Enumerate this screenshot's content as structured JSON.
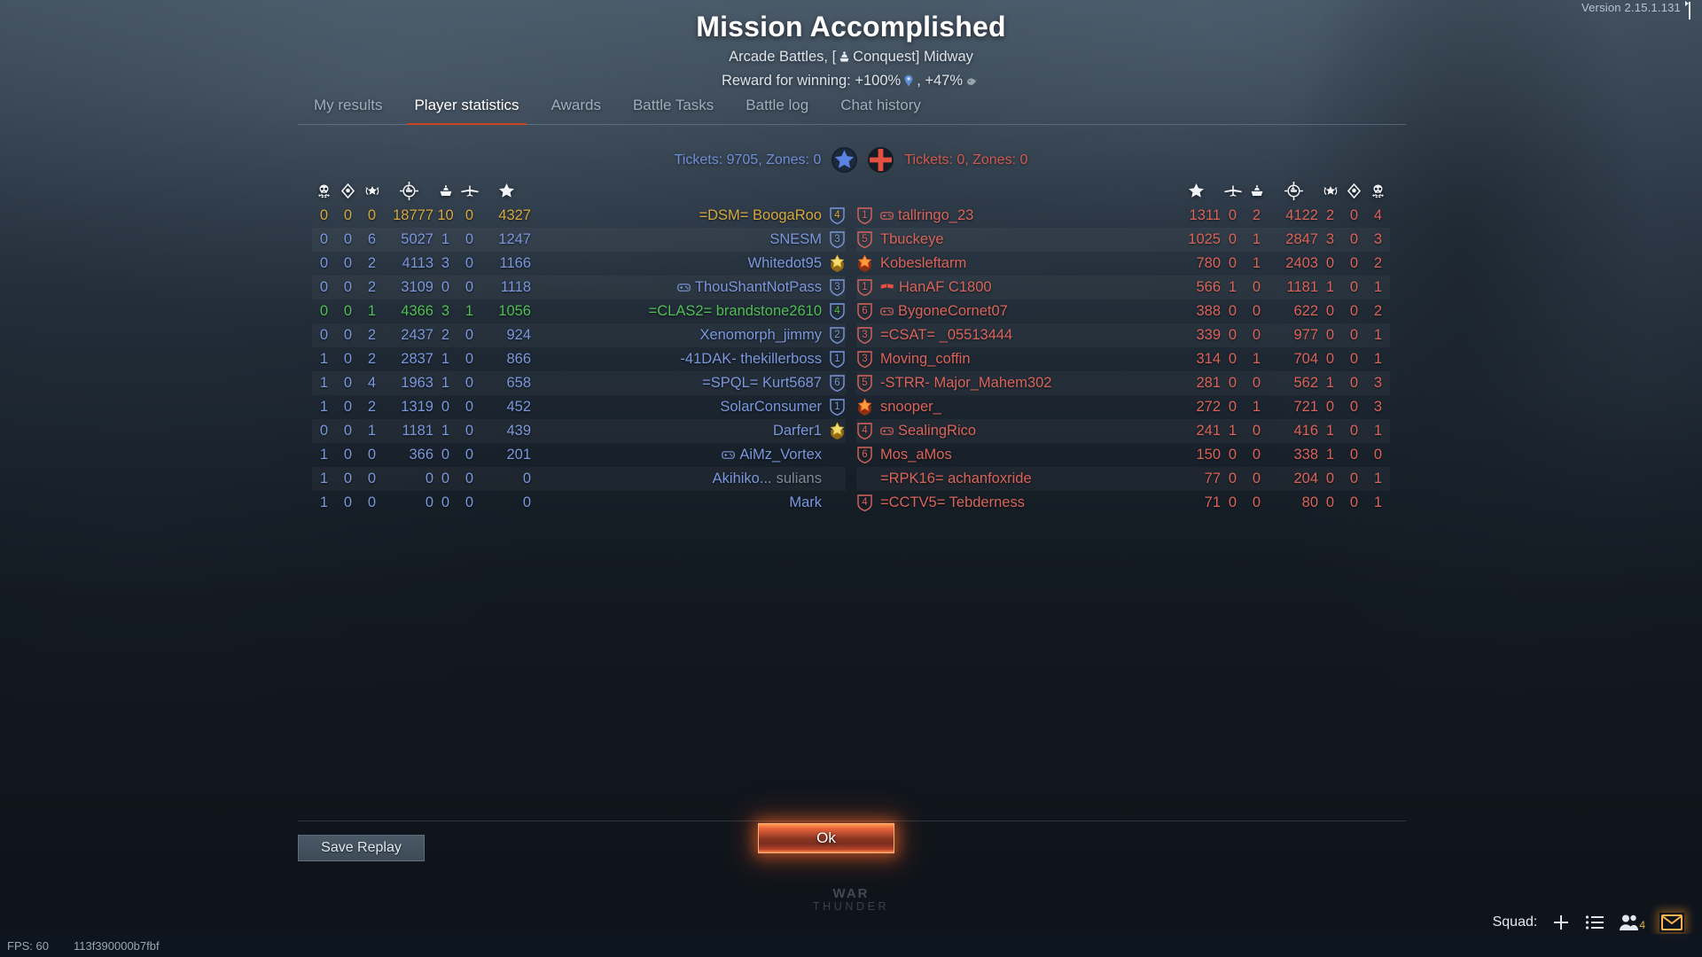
{
  "version_label": "Version 2.15.1.131",
  "header": {
    "title": "Mission Accomplished",
    "mode_prefix": "Arcade Battles, [",
    "mode_name": "Conquest",
    "mode_suffix": "] Midway",
    "reward_prefix": "Reward for winning: +100%",
    "reward_mid": ", +47%"
  },
  "tabs": [
    {
      "label": "My results",
      "active": false
    },
    {
      "label": "Player statistics",
      "active": true
    },
    {
      "label": "Awards",
      "active": false
    },
    {
      "label": "Battle Tasks",
      "active": false
    },
    {
      "label": "Battle log",
      "active": false
    },
    {
      "label": "Chat history",
      "active": false
    }
  ],
  "tickets": {
    "blue": "Tickets: 9705, Zones: 0",
    "red": "Tickets: 0, Zones: 0",
    "blue_color": "#6f8fd6",
    "red_color": "#cf5a4e"
  },
  "columns": {
    "left": [
      "skull-icon",
      "diamond-icon",
      "wreath-star-icon",
      "crosshair-ship-icon",
      "ship-icon",
      "plane-icon",
      "star-icon"
    ],
    "right": [
      "star-icon",
      "plane-icon",
      "ship-icon",
      "crosshair-ship-icon",
      "wreath-star-icon",
      "diamond-icon",
      "skull-icon"
    ]
  },
  "teams": {
    "left": {
      "side": "blue",
      "rows": [
        {
          "deaths": "0",
          "captures": "0",
          "assists": "0",
          "score_damage": "18777",
          "ships": "10",
          "planes": "0",
          "score": "4327",
          "name": "=DSM= BoogaRoo",
          "name_dim": "",
          "badge": "4",
          "badge_type": "shield",
          "prefix_icon": "",
          "color": "gold"
        },
        {
          "deaths": "0",
          "captures": "0",
          "assists": "6",
          "score_damage": "5027",
          "ships": "1",
          "planes": "0",
          "score": "1247",
          "name": "SNESM",
          "name_dim": "",
          "badge": "3",
          "badge_type": "shield",
          "prefix_icon": "",
          "color": "blue"
        },
        {
          "deaths": "0",
          "captures": "0",
          "assists": "2",
          "score_damage": "4113",
          "ships": "3",
          "planes": "0",
          "score": "1166",
          "name": "Whitedot95",
          "name_dim": "",
          "badge": "",
          "badge_type": "gold-star",
          "prefix_icon": "",
          "color": "blue"
        },
        {
          "deaths": "0",
          "captures": "0",
          "assists": "2",
          "score_damage": "3109",
          "ships": "0",
          "planes": "0",
          "score": "1118",
          "name": "ThouShantNotPass",
          "name_dim": "",
          "badge": "3",
          "badge_type": "shield",
          "prefix_icon": "gamepad-icon",
          "color": "blue"
        },
        {
          "deaths": "0",
          "captures": "0",
          "assists": "1",
          "score_damage": "4366",
          "ships": "3",
          "planes": "1",
          "score": "1056",
          "name": "=CLAS2= brandstone2610",
          "name_dim": "",
          "badge": "4",
          "badge_type": "shield",
          "prefix_icon": "",
          "color": "green"
        },
        {
          "deaths": "0",
          "captures": "0",
          "assists": "2",
          "score_damage": "2437",
          "ships": "2",
          "planes": "0",
          "score": "924",
          "name": "Xenomorph_jimmy",
          "name_dim": "",
          "badge": "2",
          "badge_type": "shield",
          "prefix_icon": "",
          "color": "blue"
        },
        {
          "deaths": "1",
          "captures": "0",
          "assists": "2",
          "score_damage": "2837",
          "ships": "1",
          "planes": "0",
          "score": "866",
          "name": "-41DAK- thekillerboss",
          "name_dim": "",
          "badge": "1",
          "badge_type": "shield",
          "prefix_icon": "",
          "color": "blue"
        },
        {
          "deaths": "1",
          "captures": "0",
          "assists": "4",
          "score_damage": "1963",
          "ships": "1",
          "planes": "0",
          "score": "658",
          "name": "=SPQL= Kurt5687",
          "name_dim": "",
          "badge": "6",
          "badge_type": "shield",
          "prefix_icon": "",
          "color": "blue"
        },
        {
          "deaths": "1",
          "captures": "0",
          "assists": "2",
          "score_damage": "1319",
          "ships": "0",
          "planes": "0",
          "score": "452",
          "name": "SolarConsumer",
          "name_dim": "",
          "badge": "1",
          "badge_type": "shield",
          "prefix_icon": "",
          "color": "blue"
        },
        {
          "deaths": "0",
          "captures": "0",
          "assists": "1",
          "score_damage": "1181",
          "ships": "1",
          "planes": "0",
          "score": "439",
          "name": "Darfer1",
          "name_dim": "",
          "badge": "",
          "badge_type": "gold-star",
          "prefix_icon": "",
          "color": "blue"
        },
        {
          "deaths": "1",
          "captures": "0",
          "assists": "0",
          "score_damage": "366",
          "ships": "0",
          "planes": "0",
          "score": "201",
          "name": "AiMz_Vortex",
          "name_dim": "",
          "badge": "",
          "badge_type": "none",
          "prefix_icon": "gamepad-icon",
          "color": "blue"
        },
        {
          "deaths": "1",
          "captures": "0",
          "assists": "0",
          "score_damage": "0",
          "ships": "0",
          "planes": "0",
          "score": "0",
          "name": "Akihiko...",
          "name_dim": "sulians",
          "badge": "",
          "badge_type": "none",
          "prefix_icon": "",
          "color": "blue"
        },
        {
          "deaths": "1",
          "captures": "0",
          "assists": "0",
          "score_damage": "0",
          "ships": "0",
          "planes": "0",
          "score": "0",
          "name": "Mark",
          "name_dim": "",
          "badge": "",
          "badge_type": "none",
          "prefix_icon": "",
          "color": "blue"
        }
      ]
    },
    "right": {
      "side": "red",
      "rows": [
        {
          "score": "1311",
          "planes": "0",
          "ships": "2",
          "score_damage": "4122",
          "assists": "2",
          "captures": "0",
          "deaths": "4",
          "name": "tallringo_23",
          "name_dim": "",
          "badge": "1",
          "badge_type": "shield",
          "prefix_icon": "gamepad-icon",
          "color": "red"
        },
        {
          "score": "1025",
          "planes": "0",
          "ships": "1",
          "score_damage": "2847",
          "assists": "3",
          "captures": "0",
          "deaths": "3",
          "name": "Tbuckeye",
          "name_dim": "",
          "badge": "5",
          "badge_type": "shield",
          "prefix_icon": "",
          "color": "red"
        },
        {
          "score": "780",
          "planes": "0",
          "ships": "1",
          "score_damage": "2403",
          "assists": "0",
          "captures": "0",
          "deaths": "2",
          "name": "Kobesleftarm",
          "name_dim": "",
          "badge": "",
          "badge_type": "orange-star",
          "prefix_icon": "",
          "color": "red"
        },
        {
          "score": "566",
          "planes": "1",
          "ships": "0",
          "score_damage": "1181",
          "assists": "1",
          "captures": "0",
          "deaths": "1",
          "name": "HanAF C1800",
          "name_dim": "",
          "badge": "1",
          "badge_type": "shield",
          "prefix_icon": "flag-icon",
          "color": "red"
        },
        {
          "score": "388",
          "planes": "0",
          "ships": "0",
          "score_damage": "622",
          "assists": "0",
          "captures": "0",
          "deaths": "2",
          "name": "BygoneCornet07",
          "name_dim": "",
          "badge": "6",
          "badge_type": "shield",
          "prefix_icon": "gamepad-icon",
          "color": "red"
        },
        {
          "score": "339",
          "planes": "0",
          "ships": "0",
          "score_damage": "977",
          "assists": "0",
          "captures": "0",
          "deaths": "1",
          "name": "=CSAT= _05513444",
          "name_dim": "",
          "badge": "3",
          "badge_type": "shield",
          "prefix_icon": "",
          "color": "red"
        },
        {
          "score": "314",
          "planes": "0",
          "ships": "1",
          "score_damage": "704",
          "assists": "0",
          "captures": "0",
          "deaths": "1",
          "name": "Moving_coffin",
          "name_dim": "",
          "badge": "3",
          "badge_type": "shield",
          "prefix_icon": "",
          "color": "red"
        },
        {
          "score": "281",
          "planes": "0",
          "ships": "0",
          "score_damage": "562",
          "assists": "1",
          "captures": "0",
          "deaths": "3",
          "name": "-STRR- Major_Mahem302",
          "name_dim": "",
          "badge": "5",
          "badge_type": "shield",
          "prefix_icon": "",
          "color": "red"
        },
        {
          "score": "272",
          "planes": "0",
          "ships": "1",
          "score_damage": "721",
          "assists": "0",
          "captures": "0",
          "deaths": "3",
          "name": "snooper_",
          "name_dim": "",
          "badge": "",
          "badge_type": "orange-star",
          "prefix_icon": "",
          "color": "red"
        },
        {
          "score": "241",
          "planes": "1",
          "ships": "0",
          "score_damage": "416",
          "assists": "1",
          "captures": "0",
          "deaths": "1",
          "name": "SealingRico",
          "name_dim": "",
          "badge": "4",
          "badge_type": "shield",
          "prefix_icon": "gamepad-icon",
          "color": "red"
        },
        {
          "score": "150",
          "planes": "0",
          "ships": "0",
          "score_damage": "338",
          "assists": "1",
          "captures": "0",
          "deaths": "0",
          "name": "Mos_aMos",
          "name_dim": "",
          "badge": "6",
          "badge_type": "shield",
          "prefix_icon": "",
          "color": "red"
        },
        {
          "score": "77",
          "planes": "0",
          "ships": "0",
          "score_damage": "204",
          "assists": "0",
          "captures": "0",
          "deaths": "1",
          "name": "=RPK16= achanfoxride",
          "name_dim": "",
          "badge": "",
          "badge_type": "none",
          "prefix_icon": "",
          "color": "red"
        },
        {
          "score": "71",
          "planes": "0",
          "ships": "0",
          "score_damage": "80",
          "assists": "0",
          "captures": "0",
          "deaths": "1",
          "name": "=CCTV5= Tebderness",
          "name_dim": "",
          "badge": "4",
          "badge_type": "shield",
          "prefix_icon": "",
          "color": "red"
        }
      ]
    }
  },
  "footer": {
    "save_replay_label": "Save Replay",
    "ok_label": "Ok",
    "logo_line1": "WAR",
    "logo_line2": "THUNDER"
  },
  "squadbar": {
    "label": "Squad:",
    "friends_count": "4"
  },
  "statusbar": {
    "fps": "FPS: 60",
    "session": "113f390000b7fbf"
  }
}
